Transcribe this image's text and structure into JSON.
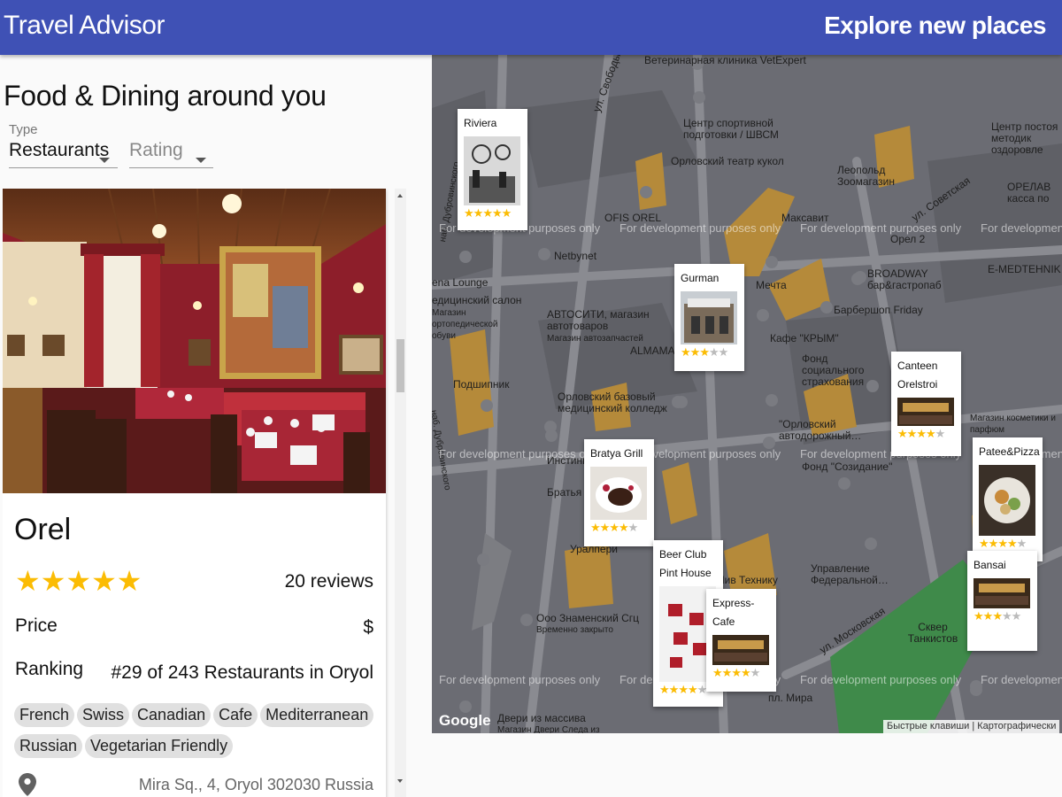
{
  "app": {
    "title": "Travel Advisor",
    "explore": "Explore new places"
  },
  "list": {
    "heading": "Food & Dining around you",
    "type_filter": {
      "label": "Type",
      "value": "Restaurants"
    },
    "rating_filter": {
      "placeholder": "Rating"
    }
  },
  "place": {
    "name": "Orel",
    "rating": 5,
    "stars_text": "★★★★★",
    "reviews": "20 reviews",
    "price_label": "Price",
    "price_value": "$",
    "ranking_label": "Ranking",
    "ranking_value": "#29 of 243 Restaurants in Oryol",
    "cuisines": [
      "French",
      "Swiss",
      "Canadian",
      "Cafe",
      "Mediterranean",
      "Russian",
      "Vegetarian Friendly"
    ],
    "address": "Mira Sq., 4, Oryol 302030 Russia"
  },
  "map": {
    "labels": [
      "Ветеринарная клиника VetExpert",
      "ул. Свободы",
      "Центр спортивной подготовки / ШВСМ",
      "Орловский театр кукол",
      "Леопольд Зоомагазин",
      "ОРЕЛАВ касса по",
      "Центр постоя методик оздоровле",
      "ул. Советская",
      "Максавит",
      "OFIS OREL",
      "Netbynet",
      "Орел 2",
      "BROADWAY бар&гастропаб",
      "E-MEDTEHNIK",
      "Мечта",
      "Барбершоп Friday",
      "ena Lounge",
      "едицинский салон",
      "Магазин ортопедической обуви",
      "АВТОСИТИ, магазин автотоваров",
      "Магазин автозапчастей",
      "Кафе \"КРЫМ\"",
      "ALMAMA",
      "Фонд социального страхования",
      "Подшипник",
      "Орловский базовый медицинский колледж",
      "\"Орловский автодорожный…",
      "Магазин косметики и парфюм",
      "Фонд \"Созидание\"",
      "Братья Грим",
      "Инстинкт",
      "Уралпери",
      "Пив Технику",
      "Ооо Знаменский Сгц",
      "Временно закрыто",
      "Управление Федеральной…",
      "ул. Московская",
      "Сквер Танкистов",
      "Двери из массива",
      "пл. Мира",
      "наб. Дубровинского",
      "наб. Дубровинского",
      "Магазин Двери Следа из"
    ],
    "dev_text": "For development purposes only",
    "google": "Google",
    "attribution": "Быстрые клавиши | Картографически"
  },
  "markers": [
    {
      "name": "Riviera",
      "rating": 5
    },
    {
      "name": "Gurman",
      "rating": 3
    },
    {
      "name": "Canteen Orelstroi",
      "rating": 4
    },
    {
      "name": "Bratya Grill",
      "rating": 4
    },
    {
      "name": "Patee&Pizza",
      "rating": 4
    },
    {
      "name": "Beer Club Pint House",
      "rating": 4
    },
    {
      "name": "Express-Cafe",
      "rating": 4
    },
    {
      "name": "Bansai",
      "rating": 3
    }
  ],
  "colors": {
    "appbar": "#3f51b5",
    "star": "#fbbc04",
    "map": "#6b6c73"
  }
}
